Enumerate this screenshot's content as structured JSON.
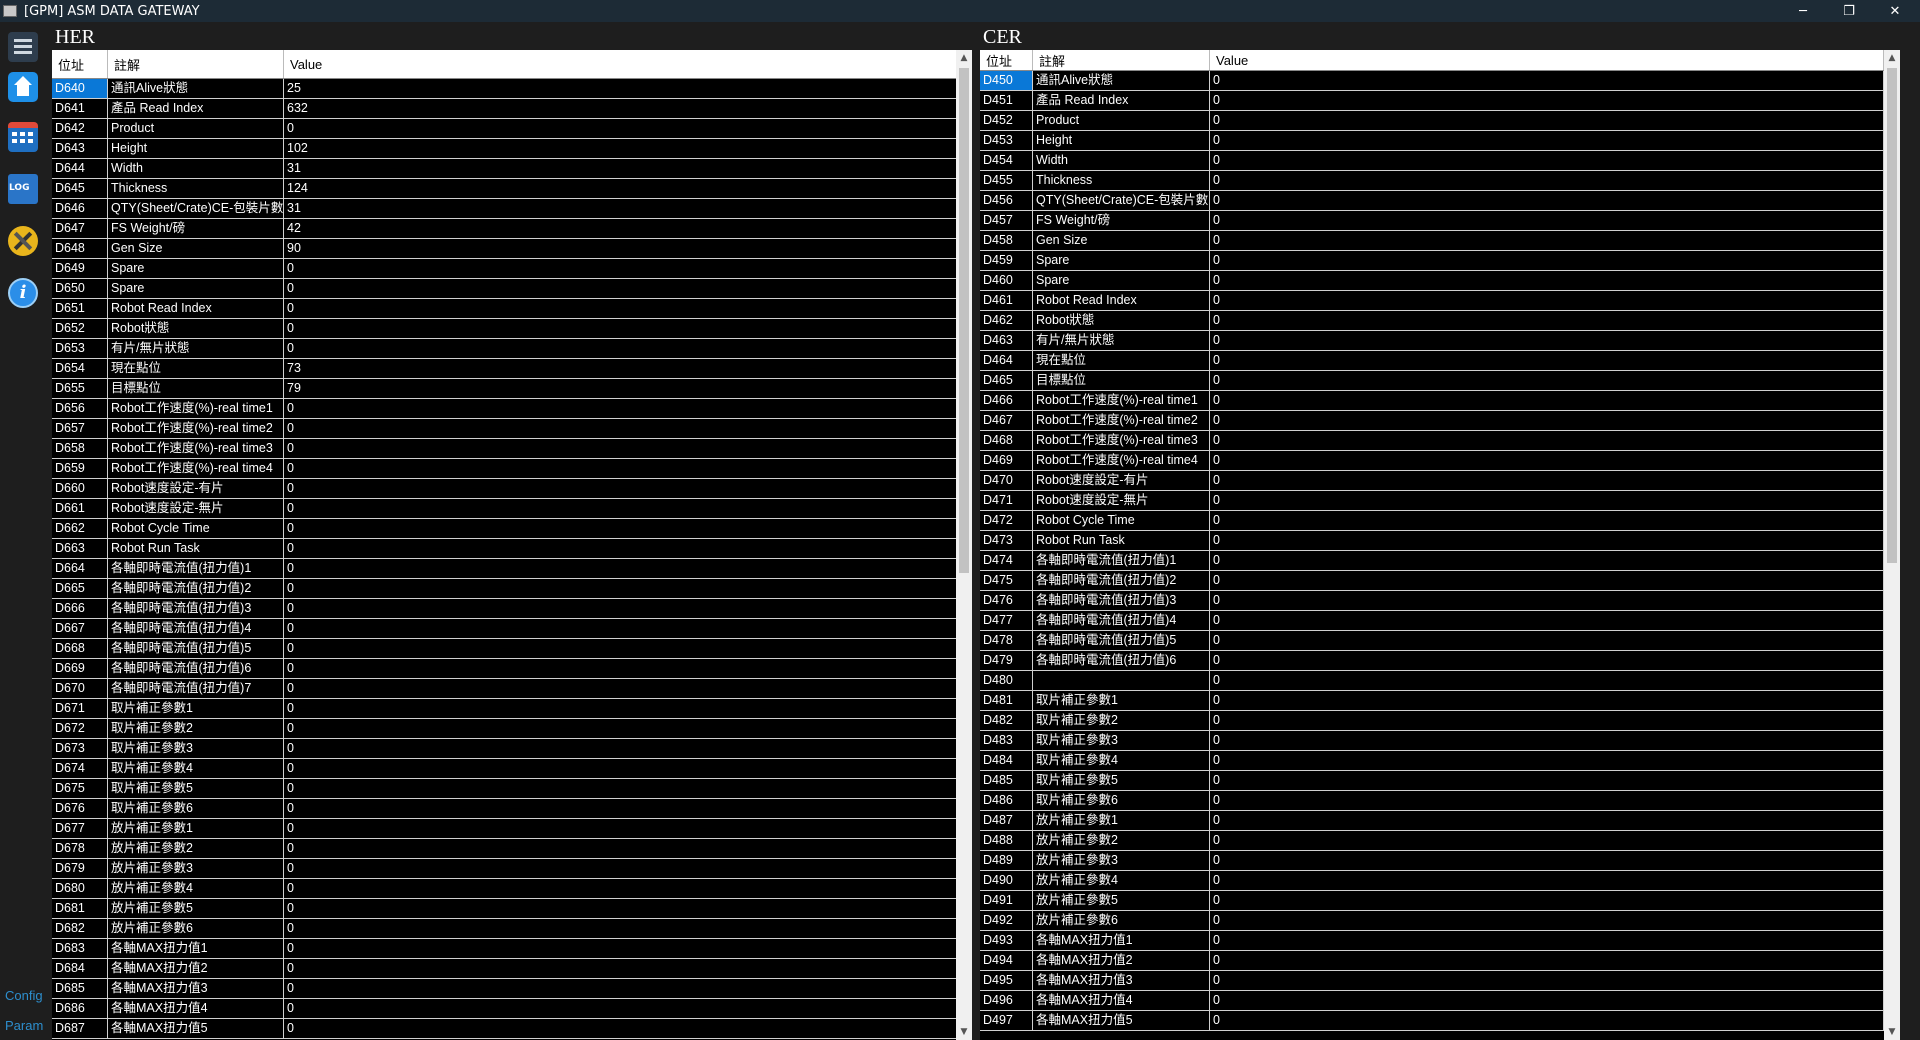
{
  "window": {
    "title": "[GPM] ASM DATA GATEWAY",
    "min": "─",
    "max": "❐",
    "close": "✕"
  },
  "sidebar": {
    "icons": [
      "menu-icon",
      "home-icon",
      "calendar-icon",
      "log-icon",
      "tools-icon",
      "info-icon"
    ],
    "log_label": "LOG",
    "info_glyph": "i",
    "config_label": "Config",
    "param_label": "Param"
  },
  "her": {
    "title": "HER",
    "headers": {
      "addr": "位址",
      "note": "註解",
      "value": "Value"
    },
    "rows": [
      {
        "addr": "D640",
        "note": "通訊Alive狀態",
        "value": "25"
      },
      {
        "addr": "D641",
        "note": "產品 Read Index",
        "value": "632"
      },
      {
        "addr": "D642",
        "note": "Product",
        "value": "0"
      },
      {
        "addr": "D643",
        "note": "Height",
        "value": "102"
      },
      {
        "addr": "D644",
        "note": "Width",
        "value": "31"
      },
      {
        "addr": "D645",
        "note": "Thickness",
        "value": "124"
      },
      {
        "addr": "D646",
        "note": "QTY(Sheet/Crate)CE-包裝片數",
        "value": "31"
      },
      {
        "addr": "D647",
        "note": "FS Weight/磅",
        "value": "42"
      },
      {
        "addr": "D648",
        "note": "Gen Size",
        "value": "90"
      },
      {
        "addr": "D649",
        "note": "Spare",
        "value": "0"
      },
      {
        "addr": "D650",
        "note": "Spare",
        "value": "0"
      },
      {
        "addr": "D651",
        "note": "Robot Read Index",
        "value": "0"
      },
      {
        "addr": "D652",
        "note": "Robot狀態",
        "value": "0"
      },
      {
        "addr": "D653",
        "note": "有片/無片狀態",
        "value": "0"
      },
      {
        "addr": "D654",
        "note": "現在點位",
        "value": "73"
      },
      {
        "addr": "D655",
        "note": "目標點位",
        "value": "79"
      },
      {
        "addr": "D656",
        "note": "Robot工作速度(%)-real time1",
        "value": "0"
      },
      {
        "addr": "D657",
        "note": "Robot工作速度(%)-real time2",
        "value": "0"
      },
      {
        "addr": "D658",
        "note": "Robot工作速度(%)-real time3",
        "value": "0"
      },
      {
        "addr": "D659",
        "note": "Robot工作速度(%)-real time4",
        "value": "0"
      },
      {
        "addr": "D660",
        "note": "Robot速度設定-有片",
        "value": "0"
      },
      {
        "addr": "D661",
        "note": "Robot速度設定-無片",
        "value": "0"
      },
      {
        "addr": "D662",
        "note": "Robot Cycle Time",
        "value": "0"
      },
      {
        "addr": "D663",
        "note": "Robot Run Task",
        "value": "0"
      },
      {
        "addr": "D664",
        "note": "各軸即時電流值(扭力值)1",
        "value": "0"
      },
      {
        "addr": "D665",
        "note": "各軸即時電流值(扭力值)2",
        "value": "0"
      },
      {
        "addr": "D666",
        "note": "各軸即時電流值(扭力值)3",
        "value": "0"
      },
      {
        "addr": "D667",
        "note": "各軸即時電流值(扭力值)4",
        "value": "0"
      },
      {
        "addr": "D668",
        "note": "各軸即時電流值(扭力值)5",
        "value": "0"
      },
      {
        "addr": "D669",
        "note": "各軸即時電流值(扭力值)6",
        "value": "0"
      },
      {
        "addr": "D670",
        "note": "各軸即時電流值(扭力值)7",
        "value": "0"
      },
      {
        "addr": "D671",
        "note": "取片補正參數1",
        "value": "0"
      },
      {
        "addr": "D672",
        "note": "取片補正參數2",
        "value": "0"
      },
      {
        "addr": "D673",
        "note": "取片補正參數3",
        "value": "0"
      },
      {
        "addr": "D674",
        "note": "取片補正參數4",
        "value": "0"
      },
      {
        "addr": "D675",
        "note": "取片補正參數5",
        "value": "0"
      },
      {
        "addr": "D676",
        "note": "取片補正參數6",
        "value": "0"
      },
      {
        "addr": "D677",
        "note": "放片補正參數1",
        "value": "0"
      },
      {
        "addr": "D678",
        "note": "放片補正參數2",
        "value": "0"
      },
      {
        "addr": "D679",
        "note": "放片補正參數3",
        "value": "0"
      },
      {
        "addr": "D680",
        "note": "放片補正參數4",
        "value": "0"
      },
      {
        "addr": "D681",
        "note": "放片補正參數5",
        "value": "0"
      },
      {
        "addr": "D682",
        "note": "放片補正參數6",
        "value": "0"
      },
      {
        "addr": "D683",
        "note": "各軸MAX扭力值1",
        "value": "0"
      },
      {
        "addr": "D684",
        "note": "各軸MAX扭力值2",
        "value": "0"
      },
      {
        "addr": "D685",
        "note": "各軸MAX扭力值3",
        "value": "0"
      },
      {
        "addr": "D686",
        "note": "各軸MAX扭力值4",
        "value": "0"
      },
      {
        "addr": "D687",
        "note": "各軸MAX扭力值5",
        "value": "0"
      }
    ]
  },
  "cer": {
    "title": "CER",
    "headers": {
      "addr": "位址",
      "note": "註解",
      "value": "Value"
    },
    "rows": [
      {
        "addr": "D450",
        "note": "通訊Alive狀態",
        "value": "0"
      },
      {
        "addr": "D451",
        "note": "產品 Read Index",
        "value": "0"
      },
      {
        "addr": "D452",
        "note": "Product",
        "value": "0"
      },
      {
        "addr": "D453",
        "note": "Height",
        "value": "0"
      },
      {
        "addr": "D454",
        "note": "Width",
        "value": "0"
      },
      {
        "addr": "D455",
        "note": "Thickness",
        "value": "0"
      },
      {
        "addr": "D456",
        "note": "QTY(Sheet/Crate)CE-包裝片數",
        "value": "0"
      },
      {
        "addr": "D457",
        "note": "FS Weight/磅",
        "value": "0"
      },
      {
        "addr": "D458",
        "note": "Gen Size",
        "value": "0"
      },
      {
        "addr": "D459",
        "note": "Spare",
        "value": "0"
      },
      {
        "addr": "D460",
        "note": "Spare",
        "value": "0"
      },
      {
        "addr": "D461",
        "note": "Robot Read Index",
        "value": "0"
      },
      {
        "addr": "D462",
        "note": "Robot狀態",
        "value": "0"
      },
      {
        "addr": "D463",
        "note": "有片/無片狀態",
        "value": "0"
      },
      {
        "addr": "D464",
        "note": "現在點位",
        "value": "0"
      },
      {
        "addr": "D465",
        "note": "目標點位",
        "value": "0"
      },
      {
        "addr": "D466",
        "note": "Robot工作速度(%)-real time1",
        "value": "0"
      },
      {
        "addr": "D467",
        "note": "Robot工作速度(%)-real time2",
        "value": "0"
      },
      {
        "addr": "D468",
        "note": "Robot工作速度(%)-real time3",
        "value": "0"
      },
      {
        "addr": "D469",
        "note": "Robot工作速度(%)-real time4",
        "value": "0"
      },
      {
        "addr": "D470",
        "note": "Robot速度設定-有片",
        "value": "0"
      },
      {
        "addr": "D471",
        "note": "Robot速度設定-無片",
        "value": "0"
      },
      {
        "addr": "D472",
        "note": "Robot Cycle Time",
        "value": "0"
      },
      {
        "addr": "D473",
        "note": "Robot Run Task",
        "value": "0"
      },
      {
        "addr": "D474",
        "note": "各軸即時電流值(扭力值)1",
        "value": "0"
      },
      {
        "addr": "D475",
        "note": "各軸即時電流值(扭力值)2",
        "value": "0"
      },
      {
        "addr": "D476",
        "note": "各軸即時電流值(扭力值)3",
        "value": "0"
      },
      {
        "addr": "D477",
        "note": "各軸即時電流值(扭力值)4",
        "value": "0"
      },
      {
        "addr": "D478",
        "note": "各軸即時電流值(扭力值)5",
        "value": "0"
      },
      {
        "addr": "D479",
        "note": "各軸即時電流值(扭力值)6",
        "value": "0"
      },
      {
        "addr": "D480",
        "note": "",
        "value": "0"
      },
      {
        "addr": "D481",
        "note": "取片補正參數1",
        "value": "0"
      },
      {
        "addr": "D482",
        "note": "取片補正參數2",
        "value": "0"
      },
      {
        "addr": "D483",
        "note": "取片補正參數3",
        "value": "0"
      },
      {
        "addr": "D484",
        "note": "取片補正參數4",
        "value": "0"
      },
      {
        "addr": "D485",
        "note": "取片補正參數5",
        "value": "0"
      },
      {
        "addr": "D486",
        "note": "取片補正參數6",
        "value": "0"
      },
      {
        "addr": "D487",
        "note": "放片補正參數1",
        "value": "0"
      },
      {
        "addr": "D488",
        "note": "放片補正參數2",
        "value": "0"
      },
      {
        "addr": "D489",
        "note": "放片補正參數3",
        "value": "0"
      },
      {
        "addr": "D490",
        "note": "放片補正參數4",
        "value": "0"
      },
      {
        "addr": "D491",
        "note": "放片補正參數5",
        "value": "0"
      },
      {
        "addr": "D492",
        "note": "放片補正參數6",
        "value": "0"
      },
      {
        "addr": "D493",
        "note": "各軸MAX扭力值1",
        "value": "0"
      },
      {
        "addr": "D494",
        "note": "各軸MAX扭力值2",
        "value": "0"
      },
      {
        "addr": "D495",
        "note": "各軸MAX扭力值3",
        "value": "0"
      },
      {
        "addr": "D496",
        "note": "各軸MAX扭力值4",
        "value": "0"
      },
      {
        "addr": "D497",
        "note": "各軸MAX扭力值5",
        "value": "0"
      }
    ]
  },
  "colors": {
    "selected": "#0a78d7",
    "titlebar": "#1d2b36",
    "background": "#1e1e1e",
    "grid": "#000000",
    "side_link": "#2d8ecd"
  }
}
